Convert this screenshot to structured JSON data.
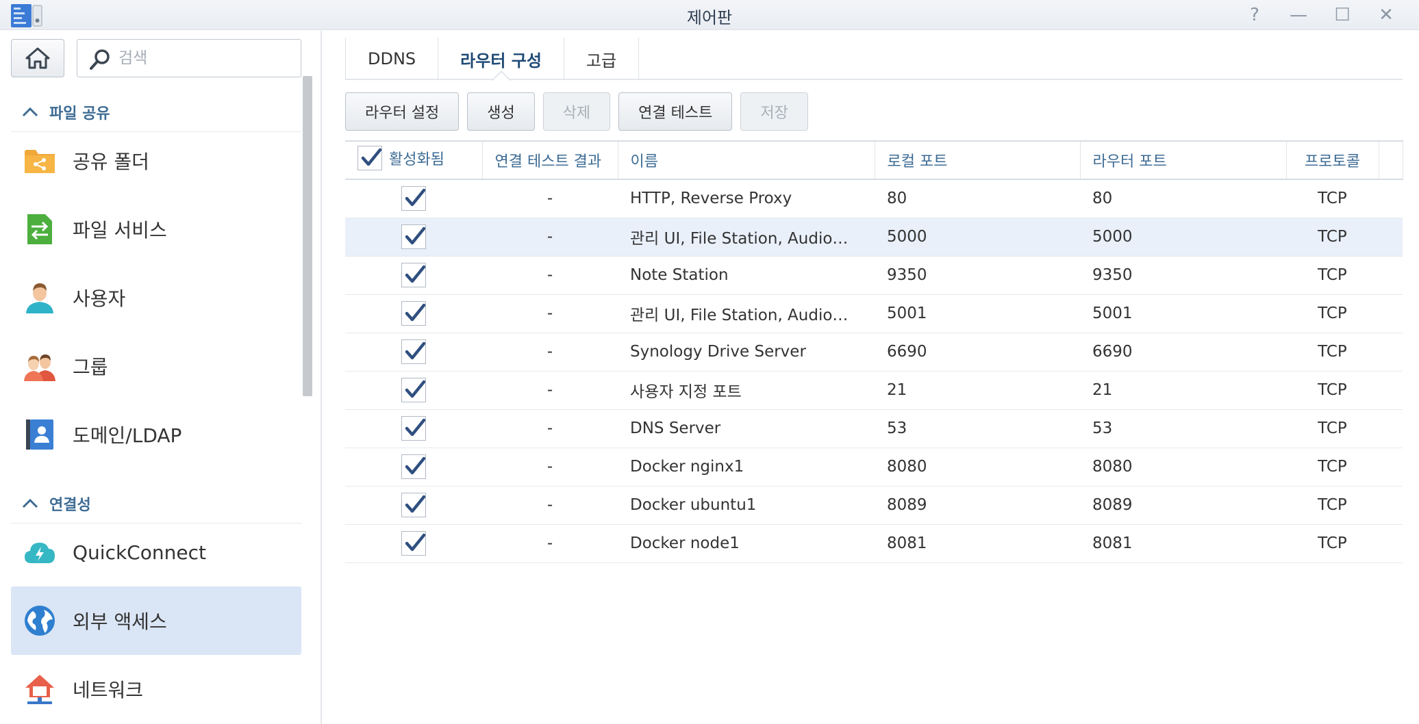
{
  "window": {
    "title": "제어판",
    "help": "?",
    "minimize": "—",
    "maximize": "☐",
    "close": "✕"
  },
  "sidebar": {
    "search_placeholder": "검색",
    "sections": [
      {
        "label": "파일 공유",
        "items": [
          {
            "label": "공유 폴더",
            "icon": "shared-folder-icon"
          },
          {
            "label": "파일 서비스",
            "icon": "file-services-icon"
          },
          {
            "label": "사용자",
            "icon": "user-icon"
          },
          {
            "label": "그룹",
            "icon": "group-icon"
          },
          {
            "label": "도메인/LDAP",
            "icon": "domain-ldap-icon"
          }
        ]
      },
      {
        "label": "연결성",
        "items": [
          {
            "label": "QuickConnect",
            "icon": "quickconnect-icon"
          },
          {
            "label": "외부 액세스",
            "icon": "external-access-icon",
            "active": true
          },
          {
            "label": "네트워크",
            "icon": "network-icon"
          }
        ]
      }
    ]
  },
  "tabs": [
    {
      "label": "DDNS"
    },
    {
      "label": "라우터 구성",
      "active": true
    },
    {
      "label": "고급"
    }
  ],
  "toolbar": {
    "router_setup": "라우터 설정",
    "create": "생성",
    "delete": "삭제",
    "test_connection": "연결 테스트",
    "save": "저장"
  },
  "table": {
    "columns": [
      "활성화됨",
      "연결 테스트 결과",
      "이름",
      "로컬 포트",
      "라우터 포트",
      "프로토콜"
    ],
    "rows": [
      {
        "enabled": true,
        "test": "-",
        "name": "HTTP, Reverse Proxy",
        "local": "80",
        "router": "80",
        "protocol": "TCP"
      },
      {
        "enabled": true,
        "test": "-",
        "name": "관리 UI, File Station, Audio…",
        "local": "5000",
        "router": "5000",
        "protocol": "TCP",
        "selected": true
      },
      {
        "enabled": true,
        "test": "-",
        "name": "Note Station",
        "local": "9350",
        "router": "9350",
        "protocol": "TCP"
      },
      {
        "enabled": true,
        "test": "-",
        "name": "관리 UI, File Station, Audio…",
        "local": "5001",
        "router": "5001",
        "protocol": "TCP"
      },
      {
        "enabled": true,
        "test": "-",
        "name": "Synology Drive Server",
        "local": "6690",
        "router": "6690",
        "protocol": "TCP"
      },
      {
        "enabled": true,
        "test": "-",
        "name": "사용자 지정 포트",
        "local": "21",
        "router": "21",
        "protocol": "TCP"
      },
      {
        "enabled": true,
        "test": "-",
        "name": "DNS Server",
        "local": "53",
        "router": "53",
        "protocol": "TCP"
      },
      {
        "enabled": true,
        "test": "-",
        "name": "Docker nginx1",
        "local": "8080",
        "router": "8080",
        "protocol": "TCP"
      },
      {
        "enabled": true,
        "test": "-",
        "name": "Docker ubuntu1",
        "local": "8089",
        "router": "8089",
        "protocol": "TCP"
      },
      {
        "enabled": true,
        "test": "-",
        "name": "Docker node1",
        "local": "8081",
        "router": "8081",
        "protocol": "TCP"
      }
    ]
  },
  "colors": {
    "accent": "#3d6b94",
    "active_nav": "#dae5f5",
    "selected_row": "#e9f0fa",
    "check": "#2f4f7f"
  }
}
